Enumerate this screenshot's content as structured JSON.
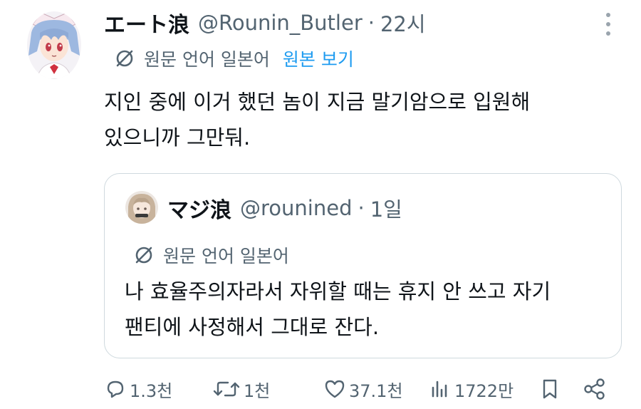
{
  "tweet": {
    "display_name": "エート浪",
    "handle": "@Rounin_Butler",
    "separator": "·",
    "time": "22시",
    "translate": {
      "language_note": "원문 언어 일본어",
      "show_original": "원본 보기"
    },
    "text_lines": [
      "지인 중에 이거 했던 놈이 지금 말기암으로 입원해",
      "있으니까 그만둬."
    ]
  },
  "quote": {
    "display_name": "マジ浪",
    "handle": "@rounined",
    "separator": "·",
    "time": "1일",
    "language_note": "원문 언어 일본어",
    "text_lines": [
      "나 효율주의자라서 자위할 때는 휴지 안 쓰고 자기",
      "팬티에 사정해서 그대로 잔다."
    ]
  },
  "actions": {
    "reply": "1.3천",
    "retweet": "1천",
    "like": "37.1천",
    "views": "1722만"
  },
  "colors": {
    "text": "#0f1419",
    "muted": "#536471",
    "link": "#1d9bf0",
    "border": "#cfd9de"
  },
  "icons": [
    "more-icon",
    "translate-icon",
    "reply-icon",
    "retweet-icon",
    "like-icon",
    "views-icon",
    "bookmark-icon",
    "share-icon"
  ]
}
